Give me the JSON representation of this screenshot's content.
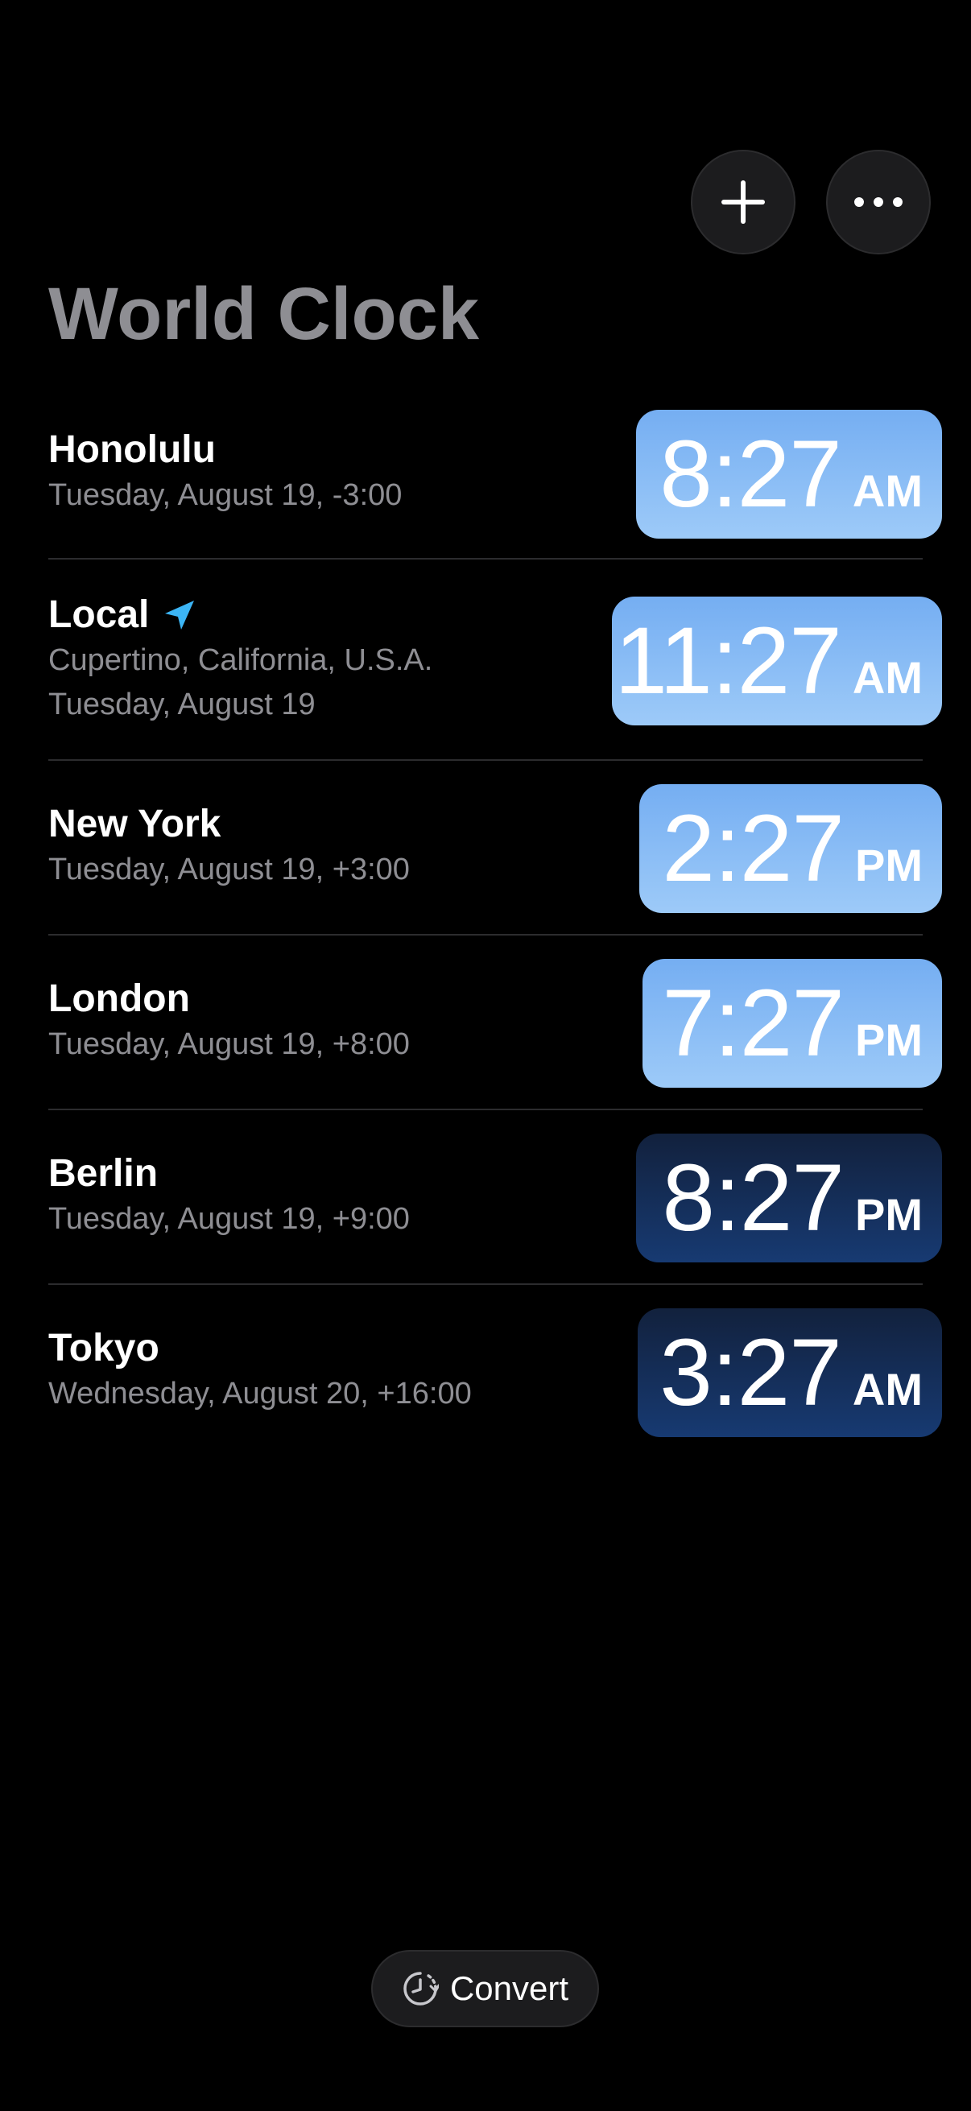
{
  "header": {
    "add_icon": "plus-icon",
    "more_icon": "ellipsis-icon",
    "title": "World Clock"
  },
  "clocks": [
    {
      "city": "Honolulu",
      "line1": "Tuesday, August 19, -3:00",
      "time": "8:27",
      "period": "AM",
      "theme": "day"
    },
    {
      "city": "Local",
      "location_icon": "location-arrow-icon",
      "line1": "Cupertino, California, U.S.A.",
      "line2": "Tuesday, August 19",
      "time": "11:27",
      "period": "AM",
      "theme": "day"
    },
    {
      "city": "New York",
      "line1": "Tuesday, August 19, +3:00",
      "time": "2:27",
      "period": "PM",
      "theme": "day"
    },
    {
      "city": "London",
      "line1": "Tuesday, August 19, +8:00",
      "time": "7:27",
      "period": "PM",
      "theme": "day"
    },
    {
      "city": "Berlin",
      "line1": "Tuesday, August 19, +9:00",
      "time": "8:27",
      "period": "PM",
      "theme": "night"
    },
    {
      "city": "Tokyo",
      "line1": "Wednesday, August 20, +16:00",
      "time": "3:27",
      "period": "AM",
      "theme": "night"
    }
  ],
  "footer": {
    "convert_icon": "clock-convert-icon",
    "convert_label": "Convert"
  },
  "colors": {
    "background": "#000000",
    "title": "#8e8e93",
    "secondary_text": "#8e8e93",
    "day_pill_top": "#75aef2",
    "day_pill_bottom": "#9dcaf8",
    "night_pill_top": "#12213d",
    "night_pill_bottom": "#173a72",
    "location_accent": "#3cb5f5"
  }
}
